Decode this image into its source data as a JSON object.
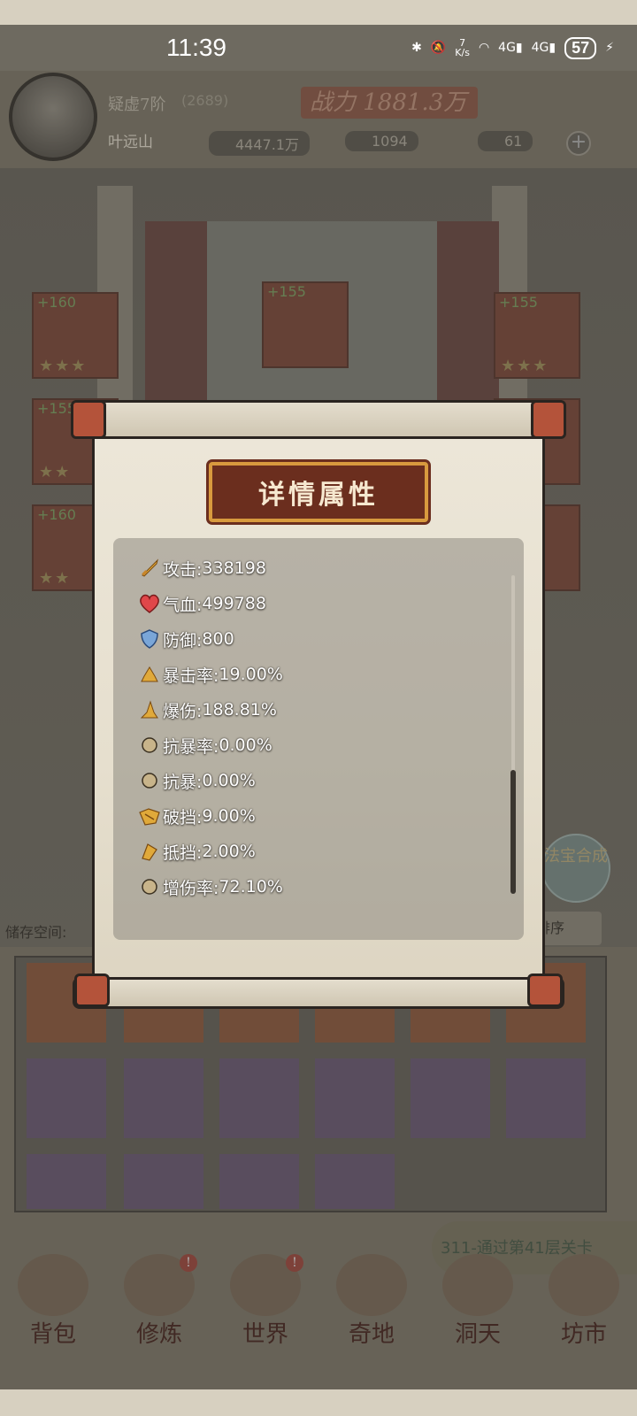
{
  "status_bar": {
    "time": "11:39",
    "net_speed": "7\nK/s",
    "signal1": "4G",
    "signal2": "4G",
    "battery": "57"
  },
  "player": {
    "realm": "疑虚7阶",
    "realm_sub": "(2689)",
    "power_label": "战力 1881.3万",
    "name": "叶远山",
    "resources": [
      {
        "icon": "spirit-stone-icon",
        "value": "4447.1万"
      },
      {
        "icon": "talisman-icon",
        "value": "1094"
      },
      {
        "icon": "flame-icon",
        "value": "61"
      }
    ]
  },
  "background_slots": {
    "plus_values": [
      "+160",
      "+155",
      "+155",
      "+155",
      "+160"
    ]
  },
  "storage": {
    "label": "储存空间:",
    "sort_label": "排序"
  },
  "synth_button": "法宝合成",
  "quest_text": "311-通过第41层关卡",
  "nav": [
    {
      "label": "背包",
      "badge": ""
    },
    {
      "label": "修炼",
      "badge": "!"
    },
    {
      "label": "世界",
      "badge": "!"
    },
    {
      "label": "奇地",
      "badge": ""
    },
    {
      "label": "洞天",
      "badge": ""
    },
    {
      "label": "坊市",
      "badge": ""
    }
  ],
  "modal": {
    "title": "详情属性",
    "stats": [
      {
        "icon": "sword-icon",
        "label": "攻击:",
        "value": "338198"
      },
      {
        "icon": "heart-icon",
        "label": "气血:",
        "value": "499788"
      },
      {
        "icon": "shield-icon",
        "label": "防御:",
        "value": "800"
      },
      {
        "icon": "crit-rate-icon",
        "label": "暴击率:",
        "value": "19.00%"
      },
      {
        "icon": "crit-damage-icon",
        "label": "爆伤:",
        "value": "188.81%"
      },
      {
        "icon": "circle-icon",
        "label": "抗暴率:",
        "value": "0.00%"
      },
      {
        "icon": "circle-icon",
        "label": "抗暴:",
        "value": "0.00%"
      },
      {
        "icon": "block-break-icon",
        "label": "破挡:",
        "value": "9.00%"
      },
      {
        "icon": "block-icon",
        "label": "抵挡:",
        "value": "2.00%"
      },
      {
        "icon": "circle-icon",
        "label": "增伤率:",
        "value": "72.10%"
      }
    ]
  },
  "colors": {
    "plaque": "#6b2e1e",
    "plaque_border": "#d89a3e",
    "rod_cap": "#b4533a"
  }
}
